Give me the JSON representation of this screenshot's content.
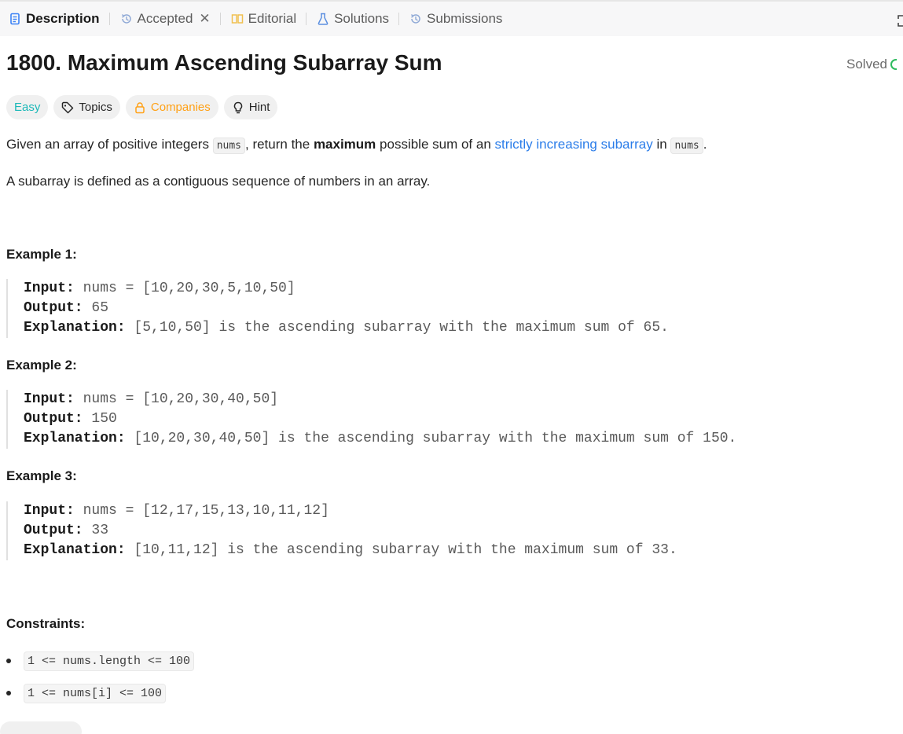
{
  "tabs": [
    {
      "label": "Description",
      "icon": "document-icon",
      "active": true
    },
    {
      "label": "Accepted",
      "icon": "history-icon",
      "closable": true
    },
    {
      "label": "Editorial",
      "icon": "book-icon"
    },
    {
      "label": "Solutions",
      "icon": "flask-icon"
    },
    {
      "label": "Submissions",
      "icon": "history-icon"
    }
  ],
  "problem": {
    "title": "1800. Maximum Ascending Subarray Sum",
    "status": "Solved"
  },
  "chips": {
    "difficulty": "Easy",
    "topics": "Topics",
    "companies": "Companies",
    "hint": "Hint"
  },
  "description": {
    "p1_a": "Given an array of positive integers ",
    "p1_code1": "nums",
    "p1_b": ", return the ",
    "p1_bold": "maximum",
    "p1_c": " possible sum of an ",
    "p1_link": "strictly increasing subarray",
    "p1_d": " in ",
    "p1_code2": "nums",
    "p1_e": ".",
    "p2": "A subarray is defined as a contiguous sequence of numbers in an array."
  },
  "examples": [
    {
      "title": "Example 1:",
      "input_label": "Input:",
      "input": " nums = [10,20,30,5,10,50]",
      "output_label": "Output:",
      "output": " 65",
      "explanation_label": "Explanation:",
      "explanation": " [5,10,50] is the ascending subarray with the maximum sum of 65."
    },
    {
      "title": "Example 2:",
      "input_label": "Input:",
      "input": " nums = [10,20,30,40,50]",
      "output_label": "Output:",
      "output": " 150",
      "explanation_label": "Explanation:",
      "explanation": " [10,20,30,40,50] is the ascending subarray with the maximum sum of 150."
    },
    {
      "title": "Example 3:",
      "input_label": "Input:",
      "input": " nums = [12,17,15,13,10,11,12]",
      "output_label": "Output:",
      "output": " 33",
      "explanation_label": "Explanation:",
      "explanation": " [10,11,12] is the ascending subarray with the maximum sum of 33."
    }
  ],
  "constraints": {
    "title": "Constraints:",
    "items": [
      "1 <= nums.length <= 100",
      "1 <= nums[i] <= 100"
    ]
  },
  "colors": {
    "easy": "#1cb8b8",
    "companies": "#ffa116",
    "link": "#2b7de9",
    "solved": "#2cbb5d",
    "active_tab_icon": "#3b82f6"
  }
}
